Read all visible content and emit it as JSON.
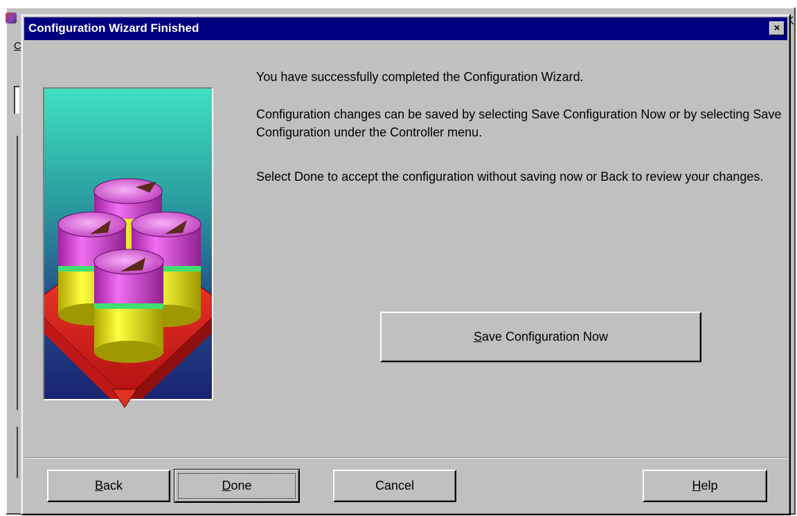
{
  "dialog": {
    "title": "Configuration Wizard Finished",
    "close_label": "×"
  },
  "background": {
    "menu_letter": "C",
    "close_glyph": "K"
  },
  "message": {
    "line1": "You have successfully completed the Configuration Wizard.",
    "line2": "Configuration changes can be saved by selecting Save Configuration Now or by selecting Save Configuration under the Controller menu.",
    "line3": "Select Done to accept the configuration without saving now or Back to review your changes."
  },
  "save_button": {
    "mnemonic": "S",
    "rest": "ave Configuration Now"
  },
  "buttons": {
    "back": {
      "mnemonic": "B",
      "rest": "ack"
    },
    "done": {
      "mnemonic": "D",
      "rest": "one"
    },
    "cancel": {
      "label": "Cancel"
    },
    "help": {
      "mnemonic": "H",
      "rest": "elp"
    }
  },
  "icons": {
    "wizard_art": "disk-array-illustration-icon",
    "app": "app-icon"
  },
  "colors": {
    "titlebar": "#000080",
    "face": "#c0c0c0",
    "art_top": "#33d6b8",
    "art_bottom": "#1a2a7a",
    "cylinder_top": "#d040d0",
    "cylinder_body": "#e8e000",
    "base": "#e02020"
  }
}
